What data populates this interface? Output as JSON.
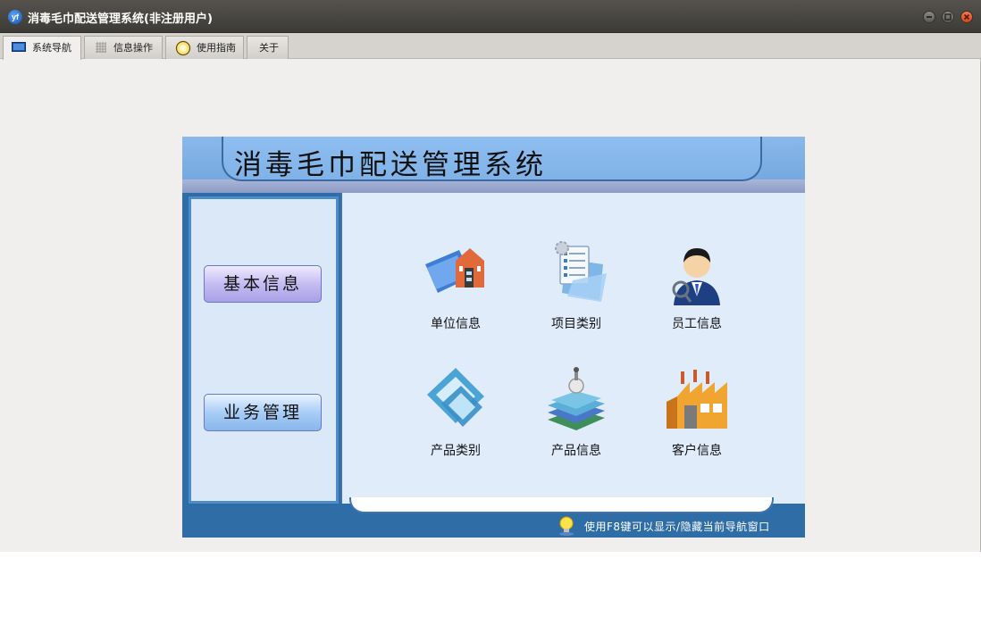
{
  "window": {
    "title": "消毒毛巾配送管理系统(非注册用户)",
    "app_icon": "yf-logo-icon",
    "controls": [
      "minimize-icon",
      "maximize-icon",
      "close-icon"
    ]
  },
  "tabs": [
    {
      "label": "系统导航",
      "icon": "monitor-icon",
      "active": true
    },
    {
      "label": "信息操作",
      "icon": "grid-icon",
      "active": false
    },
    {
      "label": "使用指南",
      "icon": "help-ring-icon",
      "active": false
    },
    {
      "label": "关于",
      "icon": "",
      "active": false
    }
  ],
  "nav": {
    "system_title": "消毒毛巾配送管理系统",
    "categories": [
      "基本信息",
      "业务管理"
    ],
    "items": [
      {
        "label": "单位信息",
        "icon": "building-folder-icon"
      },
      {
        "label": "项目类别",
        "icon": "document-list-icon"
      },
      {
        "label": "员工信息",
        "icon": "person-magnifier-icon"
      },
      {
        "label": "产品类别",
        "icon": "frames-icon"
      },
      {
        "label": "产品信息",
        "icon": "book-stack-icon"
      },
      {
        "label": "客户信息",
        "icon": "factory-icon"
      }
    ],
    "hint": "使用F8键可以显示/隐藏当前导航窗口",
    "hint_icon": "lightbulb-icon"
  },
  "colors": {
    "titlebar": "#3c3b37",
    "panel_blue": "#2f6da6",
    "header_blue": "#8ab8ea",
    "content_bg": "#e1ecfb",
    "close_button": "#e05a2b"
  }
}
